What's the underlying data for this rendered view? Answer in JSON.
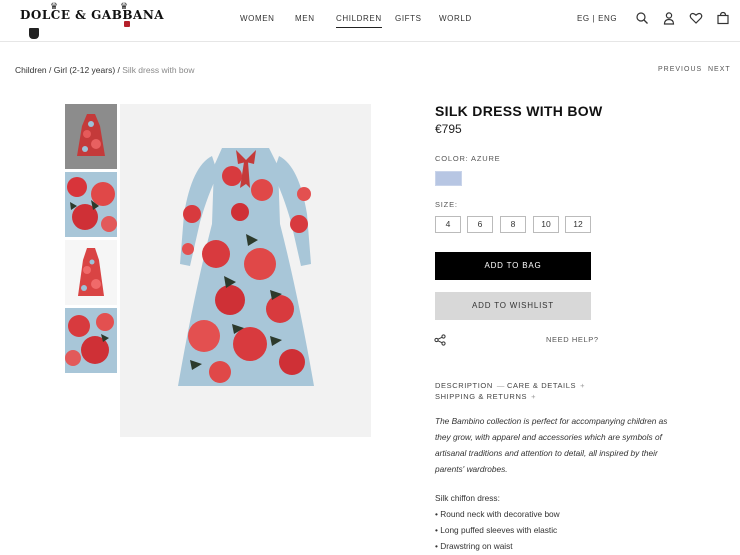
{
  "brand": {
    "logo_text": "DOLCE & GABBANA"
  },
  "nav": {
    "items": [
      "WOMEN",
      "MEN",
      "CHILDREN",
      "GIFTS",
      "WORLD"
    ],
    "active": "CHILDREN"
  },
  "utility": {
    "locale": "EG | ENG",
    "icons": [
      "search-icon",
      "account-icon",
      "heart-icon",
      "bag-icon"
    ]
  },
  "breadcrumb": {
    "items": [
      "Children",
      "Girl (2-12 years)"
    ],
    "current": "Silk dress with bow",
    "sep": " / "
  },
  "pager": {
    "previous": "PREVIOUS",
    "next": "NEXT"
  },
  "product": {
    "title": "SILK DRESS WITH BOW",
    "price": "€795",
    "color_label": "COLOR:",
    "color_value": "AZURE",
    "swatch_color": "#b7c6e3",
    "size_label": "SIZE:",
    "sizes": [
      "4",
      "6",
      "8",
      "10",
      "12"
    ],
    "add_to_bag": "ADD TO BAG",
    "add_to_wishlist": "ADD TO WISHLIST",
    "need_help": "NEED HELP?"
  },
  "tabs": {
    "description": "DESCRIPTION",
    "description_sign": "—",
    "care": "CARE & DETAILS",
    "care_sign": "+",
    "shipping": "SHIPPING & RETURNS",
    "shipping_sign": "+"
  },
  "description": {
    "text": "The Bambino collection is perfect for accompanying children as they grow, with apparel and accessories which are symbols of artisanal traditions and attention to detail, all inspired by their parents' wardrobes.",
    "spec_heading": "Silk chiffon dress:",
    "specs": [
      "• Round neck with decorative bow",
      "• Long puffed sleeves with elastic",
      "• Drawstring on waist"
    ]
  },
  "colors": {
    "accent": "#000000",
    "wishlist_bg": "#d8d8d8",
    "image_bg": "#f2f2f2"
  }
}
